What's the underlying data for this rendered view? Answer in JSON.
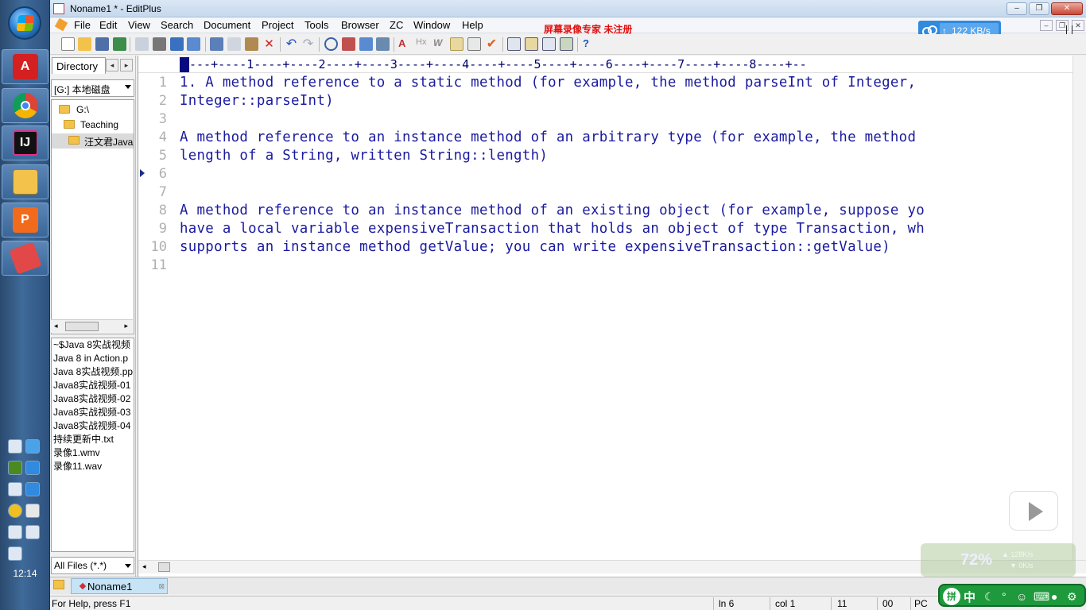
{
  "window": {
    "title": "Noname1 * - EditPlus",
    "minimize": "–",
    "restore": "❐",
    "close": "✕"
  },
  "menu": {
    "items": [
      "File",
      "Edit",
      "View",
      "Search",
      "Document",
      "Project",
      "Tools",
      "Browser",
      "ZC",
      "Window",
      "Help"
    ],
    "watermark": "屏幕录像专家  未注册"
  },
  "network_badge": {
    "speed": "122 KB/s",
    "arrow": "↑"
  },
  "directory": {
    "tab_label": "Directory",
    "left_arrow": "◂",
    "right_arrow": "▸",
    "drive": "[G:] 本地磁盘",
    "tree": [
      {
        "label": "G:\\",
        "selected": false
      },
      {
        "label": "Teaching",
        "selected": false
      },
      {
        "label": "汪文君Java",
        "selected": true
      }
    ],
    "files": [
      "~$Java 8实战视频",
      "Java 8 in Action.p",
      "Java 8实战视频.pp",
      "Java8实战视频-01",
      "Java8实战视频-02",
      "Java8实战视频-03",
      "Java8实战视频-04",
      "持续更新中.txt",
      "录像1.wmv",
      "录像11.wav"
    ],
    "filter": "All Files (*.*)"
  },
  "editor": {
    "ruler": "---+----1----+----2----+----3----+----4----+----5----+----6----+----7----+----8----+--",
    "lines": [
      "1. A method reference to a static method (for example, the method parseInt of Integer,",
      "Integer::parseInt)",
      "",
      "A method reference to an instance method of an arbitrary type (for example, the method",
      "length of a String, written String::length)",
      "",
      "",
      "A method reference to an instance method of an existing object (for example, suppose yo",
      "have a local variable expensiveTransaction that holds an object of type Transaction, wh",
      "supports an instance method getValue; you can write expensiveTransaction::getValue)",
      ""
    ],
    "line_numbers": [
      "1",
      "2",
      "3",
      "4",
      "5",
      "6",
      "7",
      "8",
      "9",
      "10",
      "11"
    ],
    "current_line": 6
  },
  "doc_tab": {
    "label": "Noname1",
    "close": "⊠"
  },
  "status": {
    "help": "For Help, press F1",
    "ln": "ln 6",
    "col": "col 1",
    "chars": "11",
    "mode": "00",
    "pc": "PC"
  },
  "taskbar": {
    "clock": "12:14"
  },
  "overlay": {
    "percent": "72%",
    "up_speed": "▲ 128K/s",
    "down_speed": "▼ 0K/s",
    "ime_badge": "拼",
    "ime_lang": "中"
  },
  "colors": {
    "code_text": "#1a1aa0",
    "ruler_text": "#000070",
    "accent": "#2f8ae0",
    "watermark": "#e01010"
  }
}
